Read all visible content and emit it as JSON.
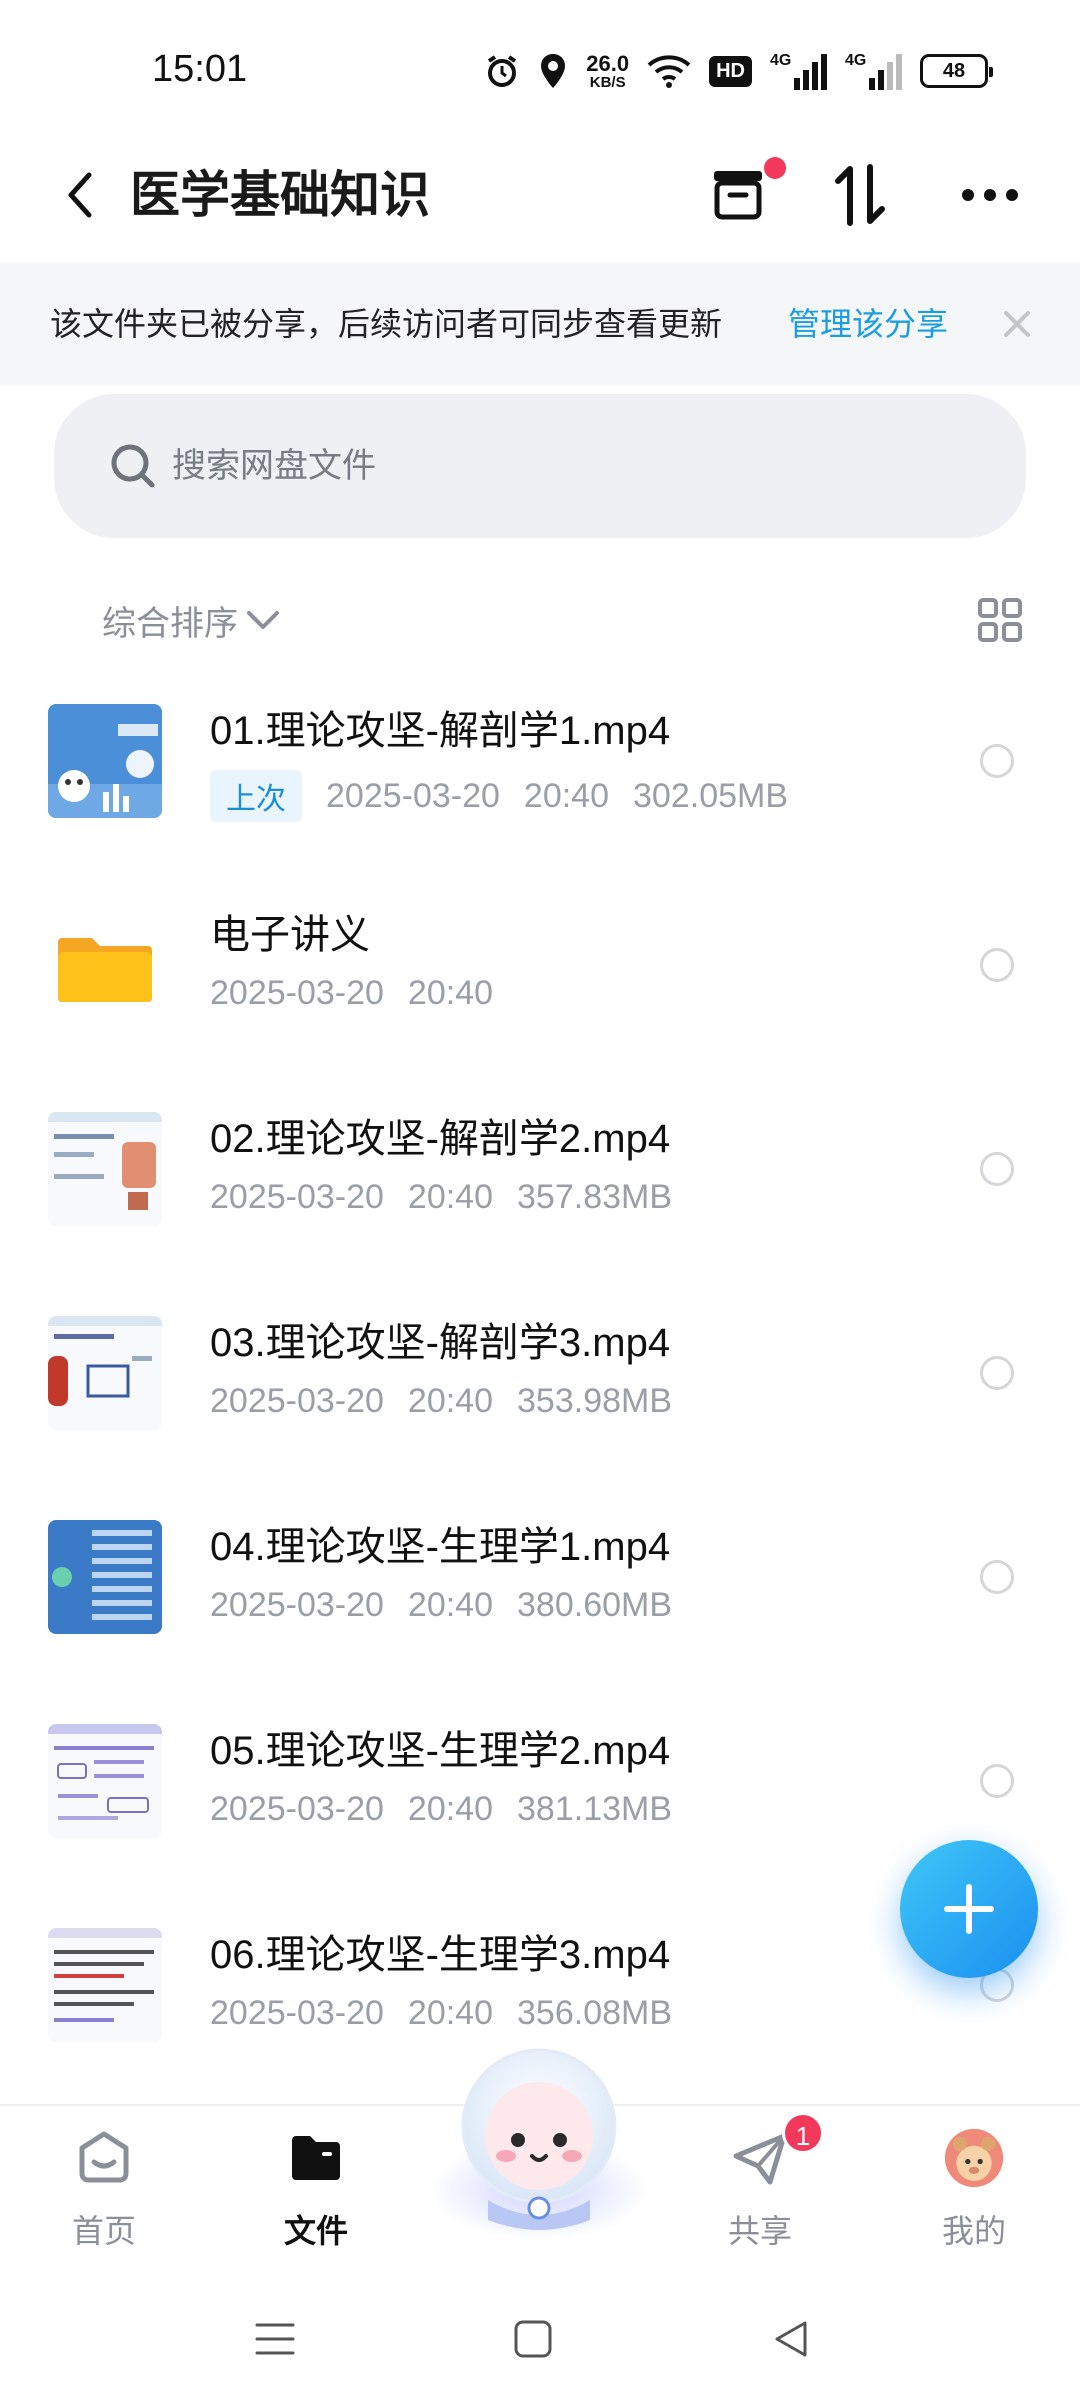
{
  "status_bar": {
    "time": "15:01",
    "net_speed_value": "26.0",
    "net_speed_unit": "KB/S",
    "hd_label": "HD",
    "signal1_label": "4G",
    "signal2_label": "4G",
    "battery": "48"
  },
  "header": {
    "title": "医学基础知识",
    "icons": [
      "back-icon",
      "archive-icon",
      "sort-transfer-icon",
      "more-icon"
    ],
    "notification_dot_color": "#f2395b"
  },
  "share_banner": {
    "text": "该文件夹已被分享，后续访问者可同步查看更新",
    "link": "管理该分享"
  },
  "search": {
    "placeholder": "搜索网盘文件"
  },
  "sort": {
    "label": "综合排序"
  },
  "files": [
    {
      "name": "01.理论攻坚-解剖学1.mp4",
      "tag": "上次",
      "date": "2025-03-20",
      "time": "20:40",
      "size": "302.05MB",
      "type": "video"
    },
    {
      "name": "电子讲义",
      "tag": "",
      "date": "2025-03-20",
      "time": "20:40",
      "size": "",
      "type": "folder"
    },
    {
      "name": "02.理论攻坚-解剖学2.mp4",
      "tag": "",
      "date": "2025-03-20",
      "time": "20:40",
      "size": "357.83MB",
      "type": "video"
    },
    {
      "name": "03.理论攻坚-解剖学3.mp4",
      "tag": "",
      "date": "2025-03-20",
      "time": "20:40",
      "size": "353.98MB",
      "type": "video"
    },
    {
      "name": "04.理论攻坚-生理学1.mp4",
      "tag": "",
      "date": "2025-03-20",
      "time": "20:40",
      "size": "380.60MB",
      "type": "video"
    },
    {
      "name": "05.理论攻坚-生理学2.mp4",
      "tag": "",
      "date": "2025-03-20",
      "time": "20:40",
      "size": "381.13MB",
      "type": "video"
    },
    {
      "name": "06.理论攻坚-生理学3.mp4",
      "tag": "",
      "date": "2025-03-20",
      "time": "20:40",
      "size": "356.08MB",
      "type": "video"
    }
  ],
  "bottom_nav": {
    "items": [
      {
        "label": "首页",
        "icon": "home-icon"
      },
      {
        "label": "文件",
        "icon": "folder-icon"
      },
      {
        "label": "共享",
        "icon": "share-icon",
        "badge": "1"
      },
      {
        "label": "我的",
        "icon": "avatar-icon"
      }
    ]
  },
  "colors": {
    "accent": "#1a9ede",
    "fab_gradient_start": "#3fc7f8",
    "fab_gradient_end": "#1b8fef",
    "badge": "#f2395b",
    "folder": "#ffc21a"
  }
}
